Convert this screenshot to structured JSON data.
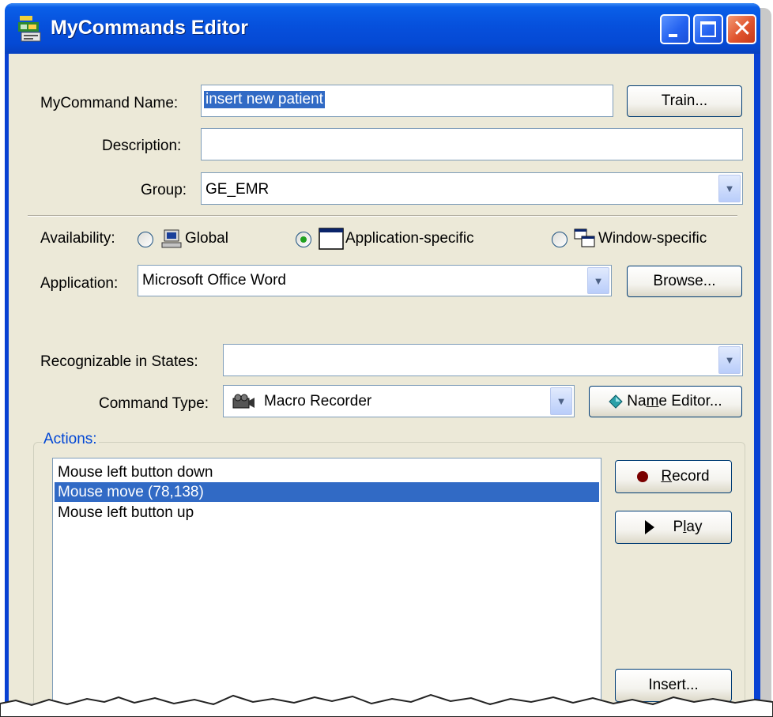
{
  "window": {
    "title": "MyCommands Editor",
    "controls": [
      "minimize",
      "maximize",
      "close"
    ]
  },
  "fields": {
    "name_label": "MyCommand Name:",
    "name_value": "insert new patient",
    "train_button": "Train...",
    "description_label": "Description:",
    "description_value": "",
    "group_label": "Group:",
    "group_value": "GE_EMR"
  },
  "availability": {
    "label": "Availability:",
    "options": [
      {
        "label": "Global",
        "icon": "computer-icon",
        "checked": false
      },
      {
        "label": "Application-specific",
        "icon": "window-icon",
        "checked": true
      },
      {
        "label": "Window-specific",
        "icon": "cascade-windows-icon",
        "checked": false
      }
    ],
    "application_label": "Application:",
    "application_value": "Microsoft Office Word",
    "browse_button": "Browse..."
  },
  "recognizable": {
    "label": "Recognizable in States:",
    "value": ""
  },
  "command_type": {
    "label": "Command Type:",
    "value": "Macro Recorder",
    "icon": "camcorder-icon",
    "name_editor_prefix": "Na",
    "name_editor_mnemonic": "m",
    "name_editor_suffix": "e Editor...",
    "name_editor_icon": "diamond-icon"
  },
  "actions": {
    "group_label": "Actions:",
    "items": [
      {
        "text": "Mouse left button down",
        "selected": false
      },
      {
        "text": "Mouse move (78,138)",
        "selected": true
      },
      {
        "text": "Mouse left button up",
        "selected": false
      }
    ],
    "record_mnemonic": "R",
    "record_rest": "ecord",
    "play_prefix": "P",
    "play_mnemonic": "l",
    "play_suffix": "ay",
    "insert_button": "Insert..."
  },
  "colors": {
    "title_bar": "#0650dc",
    "dialog_bg": "#ece9d8",
    "selection": "#316ac5",
    "group_label": "#0046d5",
    "record_dot": "#7a0000"
  }
}
